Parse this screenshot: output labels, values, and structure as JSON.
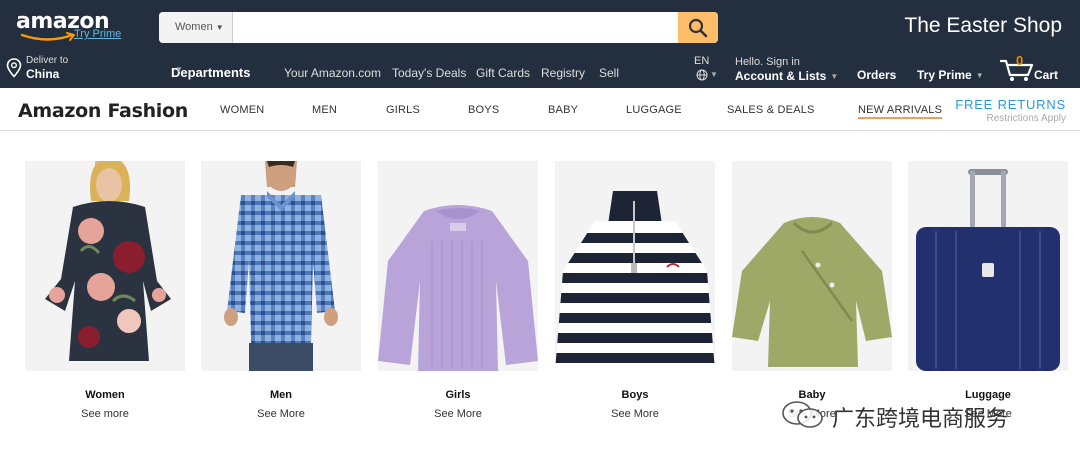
{
  "header": {
    "logo_text": "amazon",
    "try_prime": "Try Prime",
    "search": {
      "category": "Women",
      "placeholder": ""
    },
    "promo": "The Easter Shop",
    "deliver": {
      "line1": "Deliver to",
      "line2": "China"
    },
    "nav_links": [
      "Departments",
      "Your Amazon.com",
      "Today's Deals",
      "Gift Cards",
      "Registry",
      "Sell"
    ],
    "language": "EN",
    "account": {
      "line1": "Hello. Sign in",
      "line2": "Account & Lists"
    },
    "orders": "Orders",
    "try_prime_menu": "Try Prime",
    "cart": {
      "count": "0",
      "label": "Cart"
    },
    "colors": {
      "nav_bg": "#232f3e",
      "search_button": "#febd69",
      "cart_count": "#f08804",
      "prime_link": "#5fb7e5"
    }
  },
  "fashion_nav": {
    "title": "Amazon Fashion",
    "items": [
      "WOMEN",
      "MEN",
      "GIRLS",
      "BOYS",
      "BABY",
      "LUGGAGE",
      "SALES & DEALS",
      "NEW ARRIVALS"
    ],
    "active": "NEW ARRIVALS",
    "free_returns": {
      "title": "FREE RETURNS",
      "subtitle": "Restrictions Apply"
    },
    "colors": {
      "active_underline": "#f0a14a",
      "free_returns": "#2b9ad8"
    }
  },
  "categories": [
    {
      "name": "Women",
      "link": "See more",
      "image": "floral-dress"
    },
    {
      "name": "Men",
      "link": "See More",
      "image": "plaid-shirt"
    },
    {
      "name": "Girls",
      "link": "See More",
      "image": "lavender-sweater"
    },
    {
      "name": "Boys",
      "link": "See More",
      "image": "striped-sweater"
    },
    {
      "name": "Baby",
      "link": "See More",
      "image": "green-baby-top"
    },
    {
      "name": "Luggage",
      "link": "See More",
      "image": "blue-suitcase"
    }
  ],
  "watermark": {
    "text": "广东跨境电商服务"
  }
}
